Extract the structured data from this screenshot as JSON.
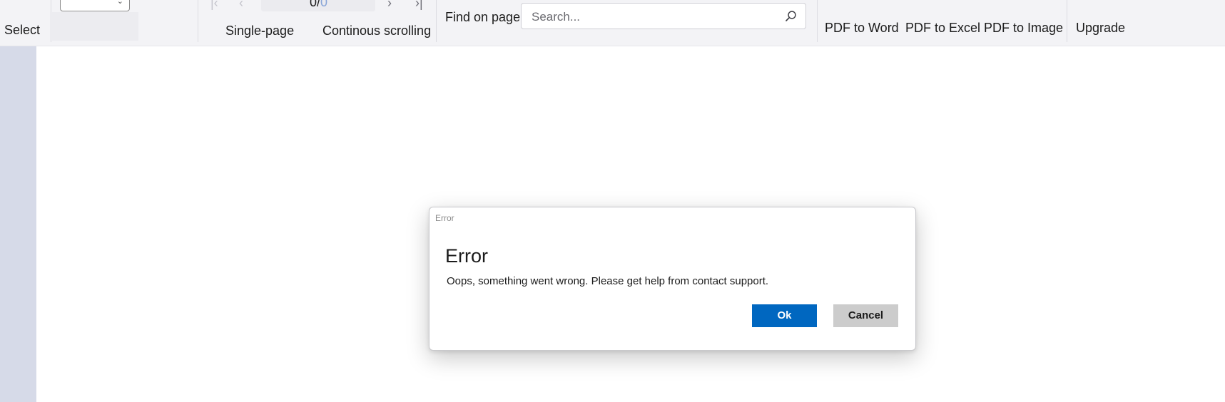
{
  "toolbar": {
    "select_label": "Select",
    "navigation": {
      "current_page": "0",
      "separator": "/",
      "total_pages": "0"
    },
    "view_modes": {
      "single_page": "Single-page",
      "continuous": "Continous scrolling"
    },
    "find": {
      "label": "Find on page",
      "placeholder": "Search..."
    },
    "convert": {
      "pdf_to_word": "PDF to Word",
      "pdf_to_excel": "PDF to Excel",
      "pdf_to_image": "PDF to Image"
    },
    "upgrade_label": "Upgrade"
  },
  "icons": {
    "first_page": "first-page-icon",
    "prev_page": "prev-page-icon",
    "next_page": "next-page-icon",
    "last_page": "last-page-icon",
    "zoom_dropdown": "chevron-down-icon",
    "search": "search-icon"
  },
  "dialog": {
    "caption": "Error",
    "title": "Error",
    "message": "Oops, something went wrong. Please get help from contact support.",
    "ok_label": "Ok",
    "cancel_label": "Cancel"
  },
  "colors": {
    "accent": "#0067c0",
    "toolbar_bg": "#f3f3f6",
    "sidebar_bg": "#d6dae8",
    "cancel_bg": "#cccccc"
  }
}
